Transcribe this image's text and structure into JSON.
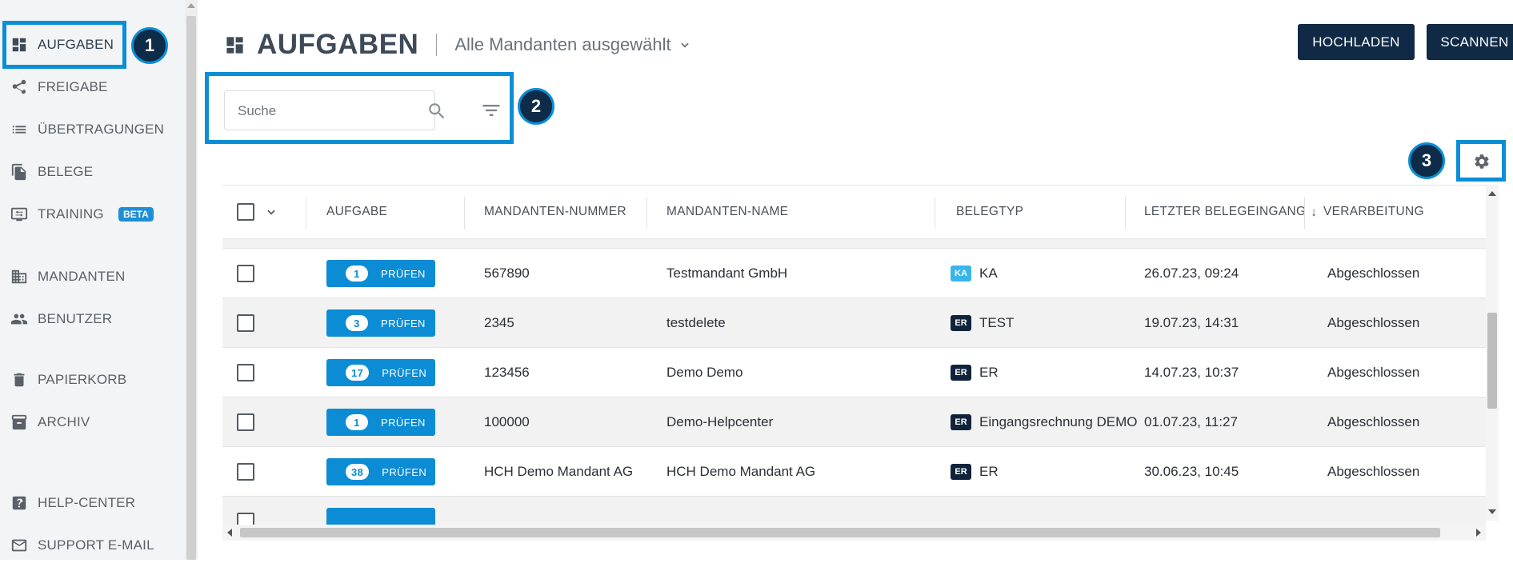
{
  "sidebar": {
    "items": [
      {
        "label": "AUFGABEN",
        "icon": "dashboard-icon"
      },
      {
        "label": "FREIGABE",
        "icon": "share-icon"
      },
      {
        "label": "ÜBERTRAGUNGEN",
        "icon": "list-icon"
      },
      {
        "label": "BELEGE",
        "icon": "documents-icon"
      },
      {
        "label": "TRAINING",
        "icon": "training-icon",
        "badge": "BETA"
      },
      {
        "label": "MANDANTEN",
        "icon": "building-icon"
      },
      {
        "label": "BENUTZER",
        "icon": "users-icon"
      },
      {
        "label": "PAPIERKORB",
        "icon": "trash-icon"
      },
      {
        "label": "ARCHIV",
        "icon": "archive-icon"
      },
      {
        "label": "HELP-CENTER",
        "icon": "help-icon"
      },
      {
        "label": "SUPPORT E-MAIL",
        "icon": "mail-icon"
      }
    ]
  },
  "callouts": {
    "one": "1",
    "two": "2",
    "three": "3"
  },
  "header": {
    "title": "AUFGABEN",
    "mandant_filter": "Alle Mandanten ausgewählt",
    "upload_label": "HOCHLADEN",
    "scan_label": "SCANNEN"
  },
  "search": {
    "placeholder": "Suche"
  },
  "table": {
    "columns": [
      "AUFGABE",
      "MANDANTEN-NUMMER",
      "MANDANTEN-NAME",
      "BELEGTYP",
      "LETZTER BELEGEINGANG",
      "VERARBEITUNG"
    ],
    "sort_indicator": "↓",
    "action_label": "PRÜFEN",
    "rows": [
      {
        "count": "1",
        "nummer": "567890",
        "name": "Testmandant GmbH",
        "tag": "KA",
        "belegtyp": "KA",
        "eingang": "26.07.23, 09:24",
        "verarbeitung": "Abgeschlossen"
      },
      {
        "count": "3",
        "nummer": "2345",
        "name": "testdelete",
        "tag": "ER",
        "belegtyp": "TEST",
        "eingang": "19.07.23, 14:31",
        "verarbeitung": "Abgeschlossen"
      },
      {
        "count": "17",
        "nummer": "123456",
        "name": "Demo Demo",
        "tag": "ER",
        "belegtyp": "ER",
        "eingang": "14.07.23, 10:37",
        "verarbeitung": "Abgeschlossen"
      },
      {
        "count": "1",
        "nummer": "100000",
        "name": "Demo-Helpcenter",
        "tag": "ER",
        "belegtyp": "Eingangsrechnung DEMO",
        "eingang": "01.07.23, 11:27",
        "verarbeitung": "Abgeschlossen"
      },
      {
        "count": "38",
        "nummer": "HCH Demo Mandant AG",
        "name": "HCH Demo Mandant AG",
        "tag": "ER",
        "belegtyp": "ER",
        "eingang": "30.06.23, 10:45",
        "verarbeitung": "Abgeschlossen"
      }
    ]
  },
  "colors": {
    "accent": "#0b8cd4",
    "dark": "#102a45",
    "highlight": "#0a8ed6"
  }
}
